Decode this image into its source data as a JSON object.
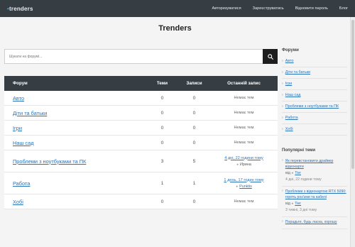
{
  "header": {
    "brand_prefix": "•",
    "brand_name": "trenders",
    "nav": [
      "Авторизуватися",
      "Зареєструватись",
      "Відновити пароль",
      "Блог"
    ]
  },
  "page": {
    "title": "Trenders"
  },
  "search": {
    "placeholder": "Шукати на форумі..."
  },
  "table": {
    "headers": [
      "Форум",
      "Теми",
      "Записи",
      "Останній запис"
    ],
    "rows": [
      {
        "name": "Авто",
        "topics": "0",
        "posts": "0",
        "last": "Немає тем"
      },
      {
        "name": "Діти та батьки",
        "topics": "0",
        "posts": "0",
        "last": "Немає тем"
      },
      {
        "name": "Ігри",
        "topics": "0",
        "posts": "0",
        "last": "Немає тем"
      },
      {
        "name": "Наш сад",
        "topics": "0",
        "posts": "0",
        "last": "Немає тем"
      },
      {
        "name": "Проблеми з ноутбуками та ПК",
        "topics": "3",
        "posts": "5",
        "last_link": "4 дні, 22 години тому",
        "last_user": "Ирина"
      },
      {
        "name": "Работа",
        "topics": "1",
        "posts": "1",
        "last_link": "1 день, 17 годин тому",
        "last_user": "Punktis"
      },
      {
        "name": "Хобі",
        "topics": "0",
        "posts": "0",
        "last": "Немає тем"
      }
    ]
  },
  "sidebar": {
    "forums_title": "Форуми",
    "forums": [
      "Авто",
      "Діти та батьки",
      "Ігри",
      "Наш сад",
      "Проблеми з ноутбуками та ПК",
      "Работа",
      "Хобі"
    ],
    "popular_title": "Популярні теми",
    "popular": [
      {
        "title": "Як перевстановити драйвер відеокарти",
        "by_prefix": "від",
        "author": "Tier",
        "date": "4 дні, 22 години тому"
      },
      {
        "title": "Проблеми з відеокартою RTX 5090: горять роз'єми та кабелі",
        "by_prefix": "від",
        "author": "Tier",
        "date": "3 тижні, 3 дні тому"
      },
      {
        "title": "Порадьте, будь ласка, хорошу"
      }
    ]
  },
  "icons": {
    "search": "search-icon",
    "user": "user-icon",
    "arrow": "chevron-right-icon"
  },
  "colors": {
    "topbar": "#363d43",
    "link": "#2a73b8",
    "accent": "#39a9d8"
  }
}
